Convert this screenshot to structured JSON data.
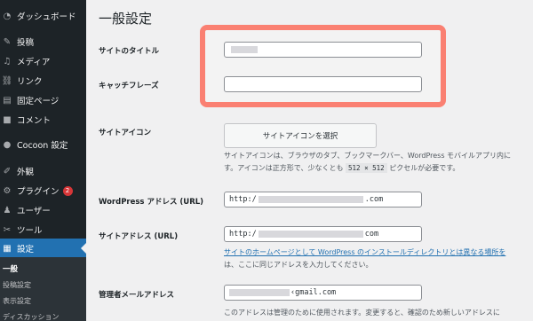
{
  "sidebar": {
    "items": [
      {
        "label": "ダッシュボード",
        "icon": "dashboard-icon",
        "glyph": "◔"
      },
      {
        "label": "投稿",
        "icon": "pin-icon",
        "glyph": "✎"
      },
      {
        "label": "メディア",
        "icon": "media-icon",
        "glyph": "♫"
      },
      {
        "label": "リンク",
        "icon": "link-icon",
        "glyph": "⛓"
      },
      {
        "label": "固定ページ",
        "icon": "page-icon",
        "glyph": "▤"
      },
      {
        "label": "コメント",
        "icon": "comment-icon",
        "glyph": "■"
      },
      {
        "label": "Cocoon 設定",
        "icon": "cocoon-icon",
        "glyph": "●"
      },
      {
        "label": "外観",
        "icon": "brush-icon",
        "glyph": "✐"
      },
      {
        "label": "プラグイン",
        "icon": "plugin-icon",
        "glyph": "⚙",
        "badge": "2"
      },
      {
        "label": "ユーザー",
        "icon": "user-icon",
        "glyph": "♟"
      },
      {
        "label": "ツール",
        "icon": "wrench-icon",
        "glyph": "✂"
      },
      {
        "label": "設定",
        "icon": "settings-icon",
        "glyph": "▦",
        "active": true
      }
    ],
    "submenu": [
      "一般",
      "投稿設定",
      "表示設定",
      "ディスカッション"
    ]
  },
  "main": {
    "title": "一般設定",
    "site_title_label": "サイトのタイトル",
    "tagline_label": "キャッチフレーズ",
    "site_icon_label": "サイトアイコン",
    "site_icon_button": "サイトアイコンを選択",
    "site_icon_desc_1": "サイトアイコンは、ブラウザのタブ、ブックマークバー、WordPress モバイルアプリ内に",
    "site_icon_desc_2a": "す。アイコンは正方形で、少なくとも",
    "site_icon_size": "512 × 512",
    "site_icon_desc_2b": "ピクセルが必要です。",
    "wp_url_label": "WordPress アドレス (URL)",
    "wp_url_prefix": "http:/",
    "wp_url_suffix": ".com",
    "site_url_label": "サイトアドレス (URL)",
    "site_url_prefix": "http:/",
    "site_url_suffix": "com",
    "site_url_desc_link": "サイトのホームページとして WordPress のインストールディレクトリとは異なる場所を",
    "site_url_desc_2": "は、ここに同じアドレスを入力してください。",
    "admin_email_label": "管理者メールアドレス",
    "admin_email_suffix": "‹gmail.com",
    "admin_email_desc": "このアドレスは管理のために使用されます。変更すると、確認のため新しいアドレスに"
  },
  "colors": {
    "sidebar_bg": "#1d2327",
    "active": "#2271b1",
    "highlight": "#fa8072",
    "badge": "#d63638"
  }
}
